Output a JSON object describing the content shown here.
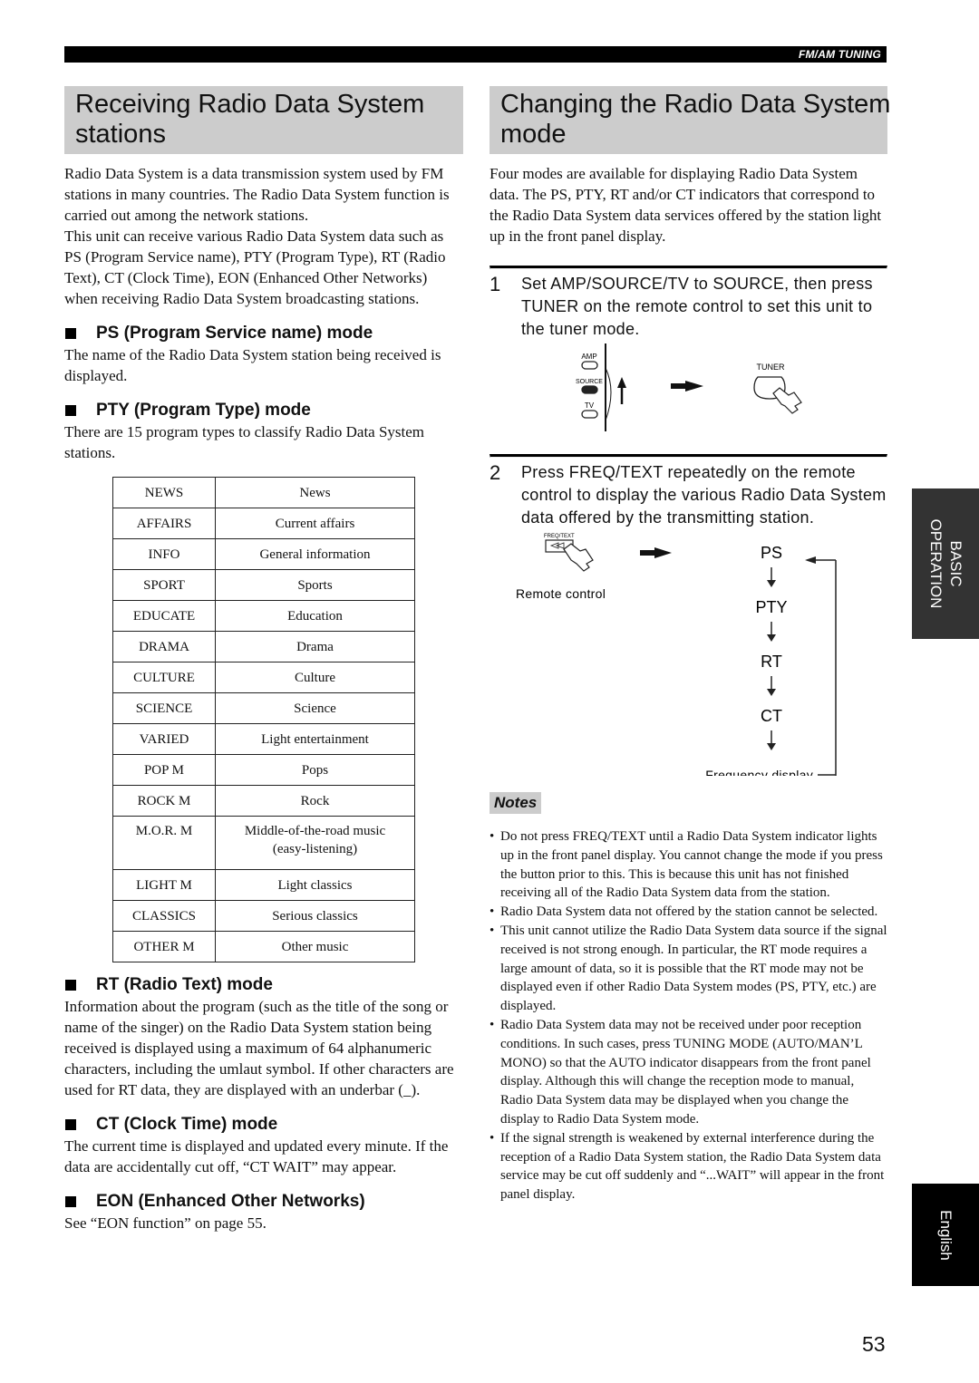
{
  "header": {
    "section_label": "FM/AM TUNING"
  },
  "left": {
    "title_line1": "Receiving Radio Data System",
    "title_line2": "stations",
    "intro": [
      "Radio Data System is a data transmission system used by FM stations in many countries. The Radio Data System function is carried out among the network stations.",
      "This unit can receive various Radio Data System data such as PS (Program Service name), PTY (Program Type), RT (Radio Text), CT (Clock Time), EON (Enhanced Other Networks) when receiving Radio Data System broadcasting stations."
    ],
    "sections": {
      "ps": {
        "heading": "PS (Program Service name) mode",
        "body": "The name of the Radio Data System station being received is displayed."
      },
      "pty": {
        "heading": "PTY (Program Type) mode",
        "body": "There are 15 program types to classify Radio Data System stations."
      },
      "rt": {
        "heading": "RT (Radio Text) mode",
        "body": "Information about the program (such as the title of the song or name of the singer) on the Radio Data System station being received is displayed using a maximum of 64 alphanumeric characters, including the umlaut symbol. If other characters are used for RT data, they are displayed with an underbar (_)."
      },
      "ct": {
        "heading": "CT (Clock Time) mode",
        "body": "The current time is displayed and updated every minute. If the data are accidentally cut off, “CT WAIT” may appear."
      },
      "eon": {
        "heading": "EON (Enhanced Other Networks)",
        "body": "See “EON function” on page 55."
      }
    },
    "pty_table": [
      {
        "code": "NEWS",
        "desc": "News"
      },
      {
        "code": "AFFAIRS",
        "desc": "Current affairs"
      },
      {
        "code": "INFO",
        "desc": "General information"
      },
      {
        "code": "SPORT",
        "desc": "Sports"
      },
      {
        "code": "EDUCATE",
        "desc": "Education"
      },
      {
        "code": "DRAMA",
        "desc": "Drama"
      },
      {
        "code": "CULTURE",
        "desc": "Culture"
      },
      {
        "code": "SCIENCE",
        "desc": "Science"
      },
      {
        "code": "VARIED",
        "desc": "Light entertainment"
      },
      {
        "code": "POP M",
        "desc": "Pops"
      },
      {
        "code": "ROCK M",
        "desc": "Rock"
      },
      {
        "code": "M.O.R. M",
        "desc": "Middle-of-the-road music",
        "desc2": "(easy-listening)"
      },
      {
        "code": "LIGHT M",
        "desc": "Light classics"
      },
      {
        "code": "CLASSICS",
        "desc": "Serious classics"
      },
      {
        "code": "OTHER M",
        "desc": "Other music"
      }
    ]
  },
  "right": {
    "title_line1": "Changing the Radio Data System",
    "title_line2": "mode",
    "intro": "Four modes are available for displaying Radio Data System data. The PS, PTY, RT and/or CT indicators that correspond to the Radio Data System data services offered by the station light up in the front panel display.",
    "steps": [
      {
        "num": "1",
        "text": "Set AMP/SOURCE/TV to SOURCE, then press TUNER on the remote control to set this unit to the tuner mode."
      },
      {
        "num": "2",
        "text": "Press FREQ/TEXT repeatedly on the remote control to display the various Radio Data System data offered by the transmitting station."
      }
    ],
    "diagram1": {
      "amp": "AMP",
      "source": "SOURCE",
      "tv": "TV",
      "tuner": "TUNER"
    },
    "diagram2": {
      "button_label": "FREQ/TEXT",
      "caption": "Remote control",
      "cycle": [
        "PS",
        "PTY",
        "RT",
        "CT"
      ],
      "last": "Frequency display"
    },
    "notes_label": "Notes",
    "notes": [
      "Do not press FREQ/TEXT until a Radio Data System indicator lights up in the front panel display. You cannot change the mode if you press the button prior to this. This is because this unit has not finished receiving all of the Radio Data System data from the station.",
      "Radio Data System data not offered by the station cannot be selected.",
      "This unit cannot utilize the Radio Data System data source if the signal received is not strong enough. In particular, the RT mode requires a large amount of data, so it is possible that the RT mode may not be displayed even if other Radio Data System modes (PS, PTY, etc.) are displayed.",
      "Radio Data System data may not be received under poor reception conditions. In such cases, press TUNING MODE (AUTO/MAN’L MONO) so that the AUTO indicator disappears from the front panel display. Although this will change the reception mode to manual, Radio Data System data may be displayed when you change the display to Radio Data System mode.",
      "If the signal strength is weakened by external interference during the reception of a Radio Data System station, the Radio Data System data service may be cut off suddenly and “...WAIT” will appear in the front panel display."
    ]
  },
  "side_tabs": {
    "basic_line1": "BASIC",
    "basic_line2": "OPERATION",
    "english": "English"
  },
  "page_number": "53"
}
